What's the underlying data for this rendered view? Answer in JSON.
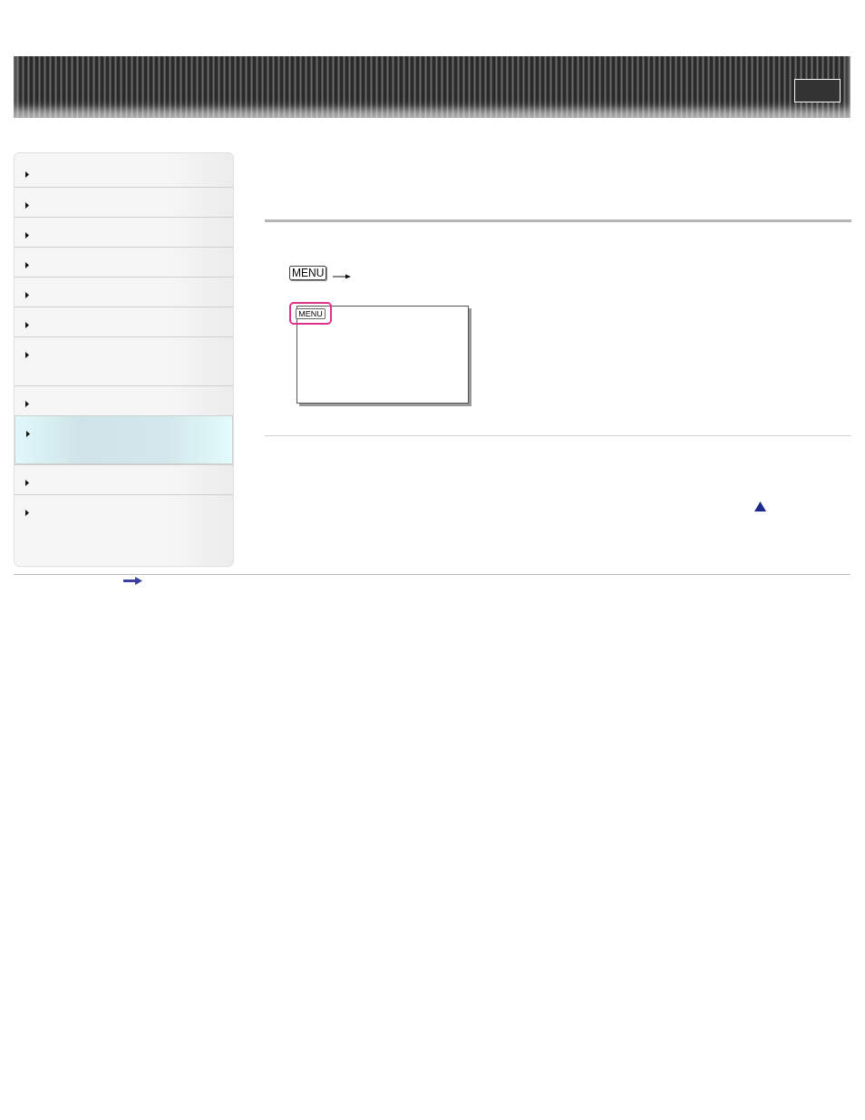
{
  "sidebar": {
    "items": [
      {
        "kind": "single",
        "selected": false
      },
      {
        "kind": "single",
        "selected": false
      },
      {
        "kind": "single",
        "selected": false
      },
      {
        "kind": "single",
        "selected": false
      },
      {
        "kind": "single",
        "selected": false
      },
      {
        "kind": "single",
        "selected": false
      },
      {
        "kind": "double",
        "selected": false
      },
      {
        "kind": "single",
        "selected": false
      },
      {
        "kind": "double",
        "selected": true
      },
      {
        "kind": "single",
        "selected": false
      },
      {
        "kind": "double",
        "selected": false
      }
    ]
  },
  "content": {
    "menu_key": "MENU",
    "screen_button": "MENU"
  }
}
